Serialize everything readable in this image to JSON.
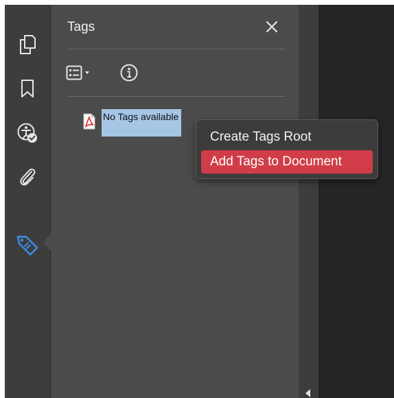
{
  "rail": {
    "icons": [
      {
        "name": "pages-icon"
      },
      {
        "name": "bookmark-icon"
      },
      {
        "name": "accessibility-check-icon"
      },
      {
        "name": "attachment-icon"
      },
      {
        "name": "tags-icon",
        "active": true
      }
    ],
    "accent_color": "#3a8fe8"
  },
  "panel": {
    "title": "Tags",
    "close_icon": "close-icon",
    "toolbar": {
      "options_icon": "options-menu-icon",
      "dropdown_icon": "caret-down-icon",
      "info_icon": "info-icon"
    },
    "tree": {
      "items": [
        {
          "label": "No Tags available",
          "icon": "pdf-file-icon"
        }
      ]
    }
  },
  "context_menu": {
    "items": [
      {
        "label": "Create Tags Root",
        "selected": false
      },
      {
        "label": "Add Tags to Document",
        "selected": true
      }
    ],
    "highlight_color": "#d03d48"
  },
  "colors": {
    "rail_bg": "#3d3d3d",
    "panel_bg": "#4b4b4b",
    "doc_bg": "#252525",
    "selection_bg": "#a6c6e6"
  }
}
